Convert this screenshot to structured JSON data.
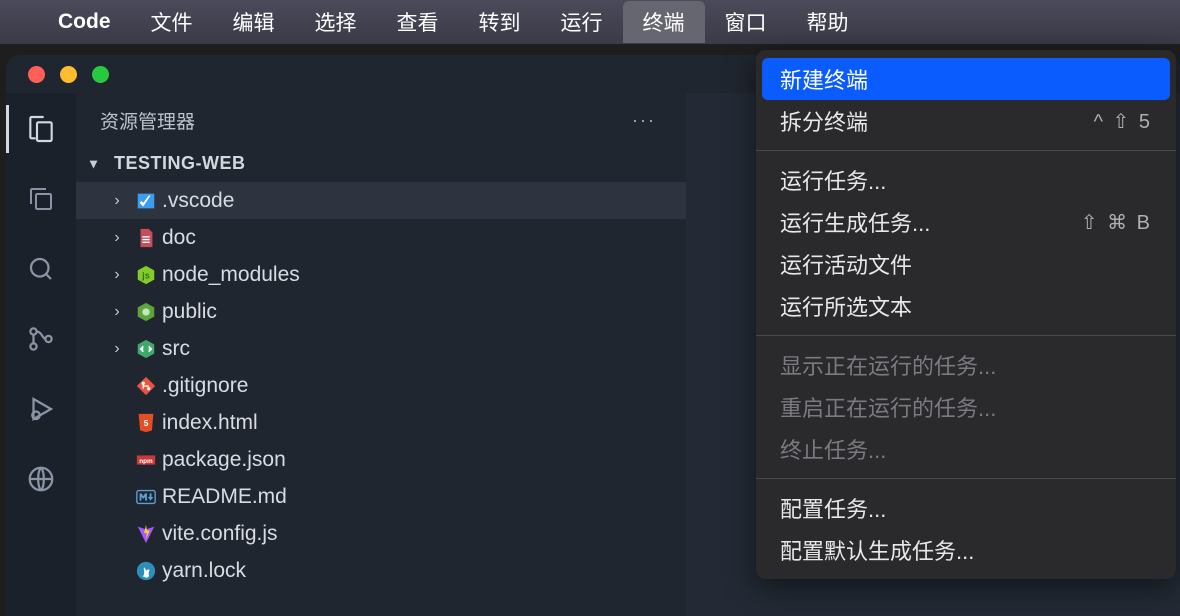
{
  "menubar": {
    "app": "Code",
    "items": [
      "文件",
      "编辑",
      "选择",
      "查看",
      "转到",
      "运行",
      "终端",
      "窗口",
      "帮助"
    ],
    "active_index": 6
  },
  "sidebar": {
    "title": "资源管理器",
    "project": "TESTING-WEB",
    "tree": [
      {
        "name": ".vscode",
        "type": "folder",
        "icon": "vscode",
        "expandable": true,
        "selected": true
      },
      {
        "name": "doc",
        "type": "folder",
        "icon": "doc",
        "expandable": true
      },
      {
        "name": "node_modules",
        "type": "folder",
        "icon": "node",
        "expandable": true
      },
      {
        "name": "public",
        "type": "folder",
        "icon": "public",
        "expandable": true
      },
      {
        "name": "src",
        "type": "folder",
        "icon": "src",
        "expandable": true
      },
      {
        "name": ".gitignore",
        "type": "file",
        "icon": "git"
      },
      {
        "name": "index.html",
        "type": "file",
        "icon": "html"
      },
      {
        "name": "package.json",
        "type": "file",
        "icon": "npm"
      },
      {
        "name": "README.md",
        "type": "file",
        "icon": "md"
      },
      {
        "name": "vite.config.js",
        "type": "file",
        "icon": "vite"
      },
      {
        "name": "yarn.lock",
        "type": "file",
        "icon": "yarn"
      }
    ]
  },
  "dropdown": {
    "groups": [
      [
        {
          "label": "新建终端",
          "shortcut": "",
          "highlight": true
        },
        {
          "label": "拆分终端",
          "shortcut": "^ ⇧ 5"
        }
      ],
      [
        {
          "label": "运行任务..."
        },
        {
          "label": "运行生成任务...",
          "shortcut": "⇧ ⌘ B"
        },
        {
          "label": "运行活动文件"
        },
        {
          "label": "运行所选文本"
        }
      ],
      [
        {
          "label": "显示正在运行的任务...",
          "disabled": true
        },
        {
          "label": "重启正在运行的任务...",
          "disabled": true
        },
        {
          "label": "终止任务...",
          "disabled": true
        }
      ],
      [
        {
          "label": "配置任务..."
        },
        {
          "label": "配置默认生成任务..."
        }
      ]
    ]
  }
}
